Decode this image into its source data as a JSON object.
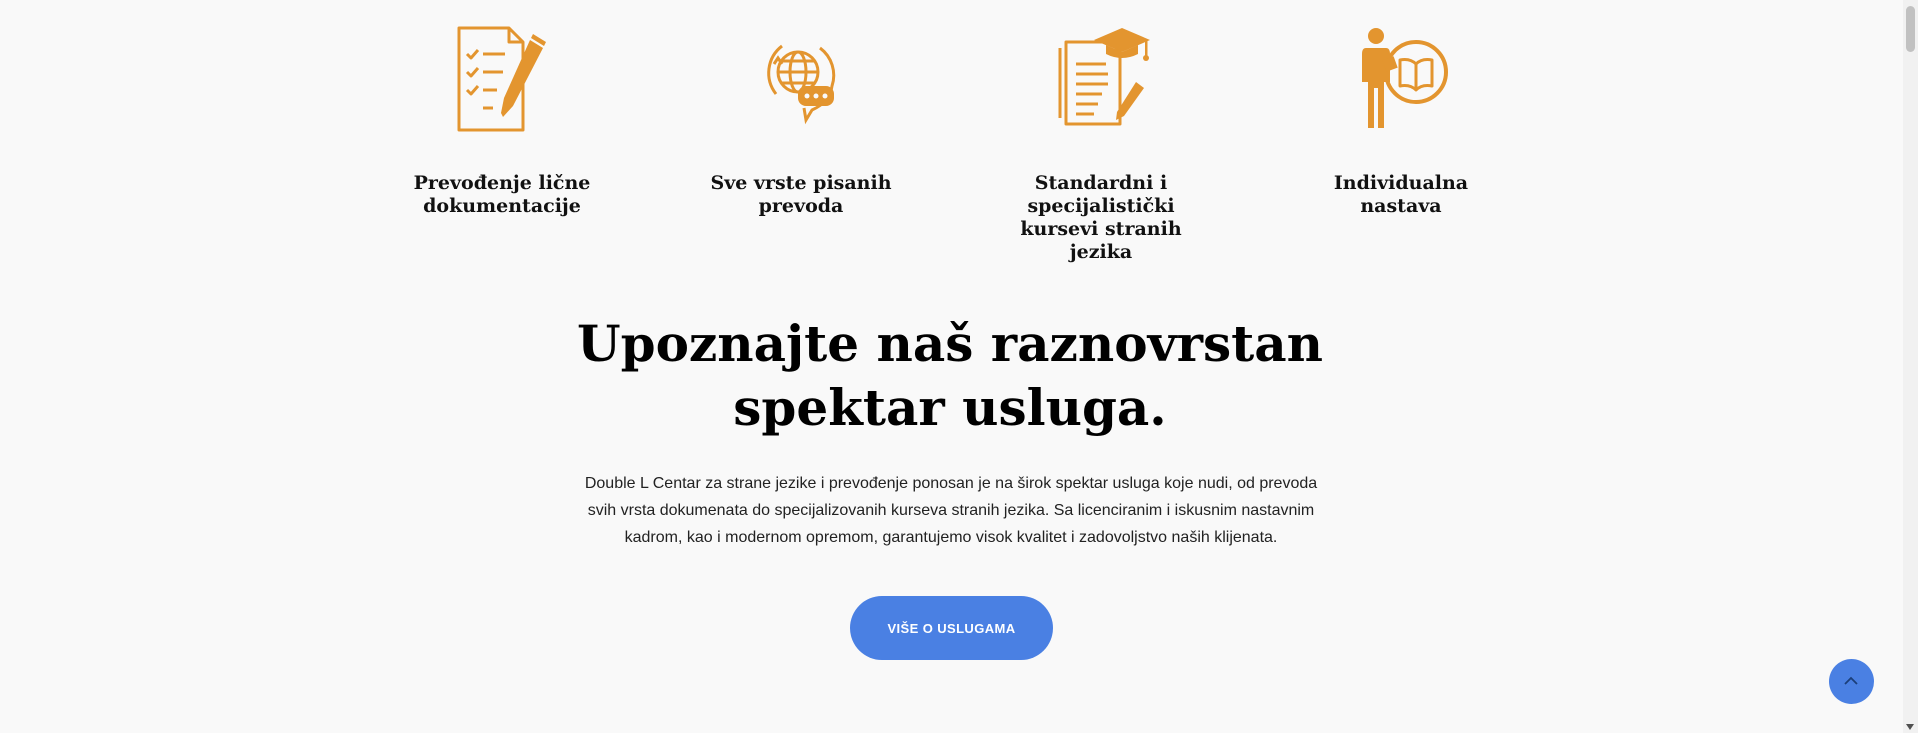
{
  "features": [
    {
      "title": "Prevođenje lične dokumentacije",
      "icon": "document-pen-icon"
    },
    {
      "title": "Sve vrste pisanih prevoda",
      "icon": "globe-speech-icon"
    },
    {
      "title": "Standardni i specijalistički kursevi stranih jezika",
      "icon": "graduation-document-icon"
    },
    {
      "title": "Individualna nastava",
      "icon": "person-book-icon"
    }
  ],
  "services": {
    "title": "Upoznajte naš raznovrstan spektar usluga.",
    "description": "Double L Centar za strane jezike i prevođenje ponosan je na širok spektar usluga koje nudi, od prevoda svih vrsta dokumenata do specijalizovanih kurseva stranih jezika. Sa licenciranim i iskusnim nastavnim kadrom, kao i modernom opremom, garantujemo visok kvalitet i zadovoljstvo naših klijenata.",
    "button_label": "VIŠE O USLUGAMA"
  },
  "scroll_top": {
    "icon": "chevron-up-icon"
  },
  "colors": {
    "accent_orange": "#e3952f",
    "button_blue": "#4a80e3",
    "background": "#f9f9f9"
  }
}
